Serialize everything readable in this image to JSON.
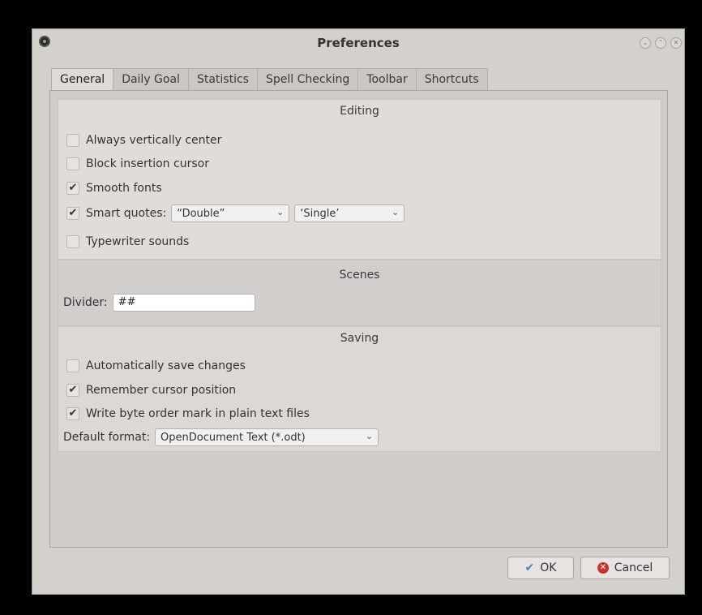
{
  "window": {
    "title": "Preferences"
  },
  "tabs": [
    {
      "label": "General",
      "active": true
    },
    {
      "label": "Daily Goal"
    },
    {
      "label": "Statistics"
    },
    {
      "label": "Spell Checking"
    },
    {
      "label": "Toolbar"
    },
    {
      "label": "Shortcuts"
    }
  ],
  "editing": {
    "title": "Editing",
    "always_center": {
      "label": "Always vertically center",
      "checked": false
    },
    "block_cursor": {
      "label": "Block insertion cursor",
      "checked": false
    },
    "smooth_fonts": {
      "label": "Smooth fonts",
      "checked": true
    },
    "smart_quotes": {
      "label": "Smart quotes:",
      "checked": true,
      "double_value": "“Double”",
      "single_value": "‘Single’"
    },
    "typewriter": {
      "label": "Typewriter sounds",
      "checked": false
    }
  },
  "scenes": {
    "title": "Scenes",
    "divider_label": "Divider:",
    "divider_value": "##"
  },
  "saving": {
    "title": "Saving",
    "auto_save": {
      "label": "Automatically save changes",
      "checked": false
    },
    "remember_cursor": {
      "label": "Remember cursor position",
      "checked": true
    },
    "write_bom": {
      "label": "Write byte order mark in plain text files",
      "checked": true
    },
    "default_format_label": "Default format:",
    "default_format_value": "OpenDocument Text (*.odt)"
  },
  "buttons": {
    "ok": "OK",
    "cancel": "Cancel"
  },
  "icons": {
    "check_mark": "✔",
    "chevron": "⌄"
  }
}
